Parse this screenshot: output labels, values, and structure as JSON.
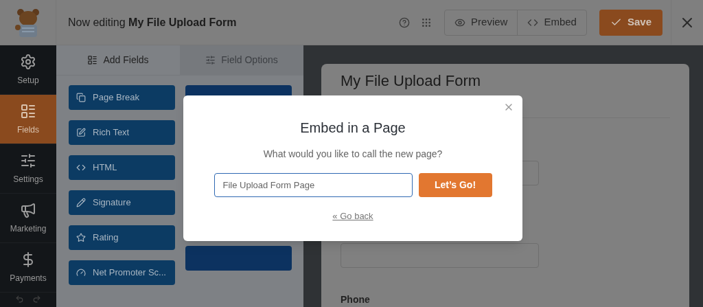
{
  "header": {
    "prefix": "Now editing",
    "form_name": "My File Upload Form",
    "buttons": [
      {
        "label": "Preview",
        "kind": "preview"
      },
      {
        "label": "Embed",
        "kind": "embed"
      }
    ],
    "save": "Save"
  },
  "sidebar": {
    "items": [
      {
        "label": "Setup",
        "kind": "gear",
        "selected": false
      },
      {
        "label": "Fields",
        "kind": "list",
        "selected": true
      },
      {
        "label": "Settings",
        "kind": "sliders",
        "selected": false
      },
      {
        "label": "Marketing",
        "kind": "megaphone",
        "selected": false
      },
      {
        "label": "Payments",
        "kind": "dollar",
        "selected": false
      }
    ]
  },
  "panel": {
    "tabs": [
      {
        "label": "Add Fields",
        "kind": "list",
        "selected": true
      },
      {
        "label": "Field Options",
        "kind": "sliders",
        "selected": false
      }
    ],
    "fields": [
      {
        "label": "Page Break",
        "kind": "pages"
      },
      {
        "label": "Rich Text",
        "kind": "edit"
      },
      {
        "label": "HTML",
        "kind": "code"
      },
      {
        "label": "Signature",
        "kind": "pencil"
      },
      {
        "label": "Rating",
        "kind": "star"
      },
      {
        "label": "Net Promoter Sc...",
        "kind": "gauge"
      }
    ]
  },
  "form": {
    "title": "My File Upload Form",
    "label": "Phone"
  },
  "modal": {
    "title": "Embed in a Page",
    "question": "What would you like to call the new page?",
    "input": {
      "value": "File Upload Form Page"
    },
    "button": "Let’s Go!",
    "back_link": "« Go back"
  }
}
